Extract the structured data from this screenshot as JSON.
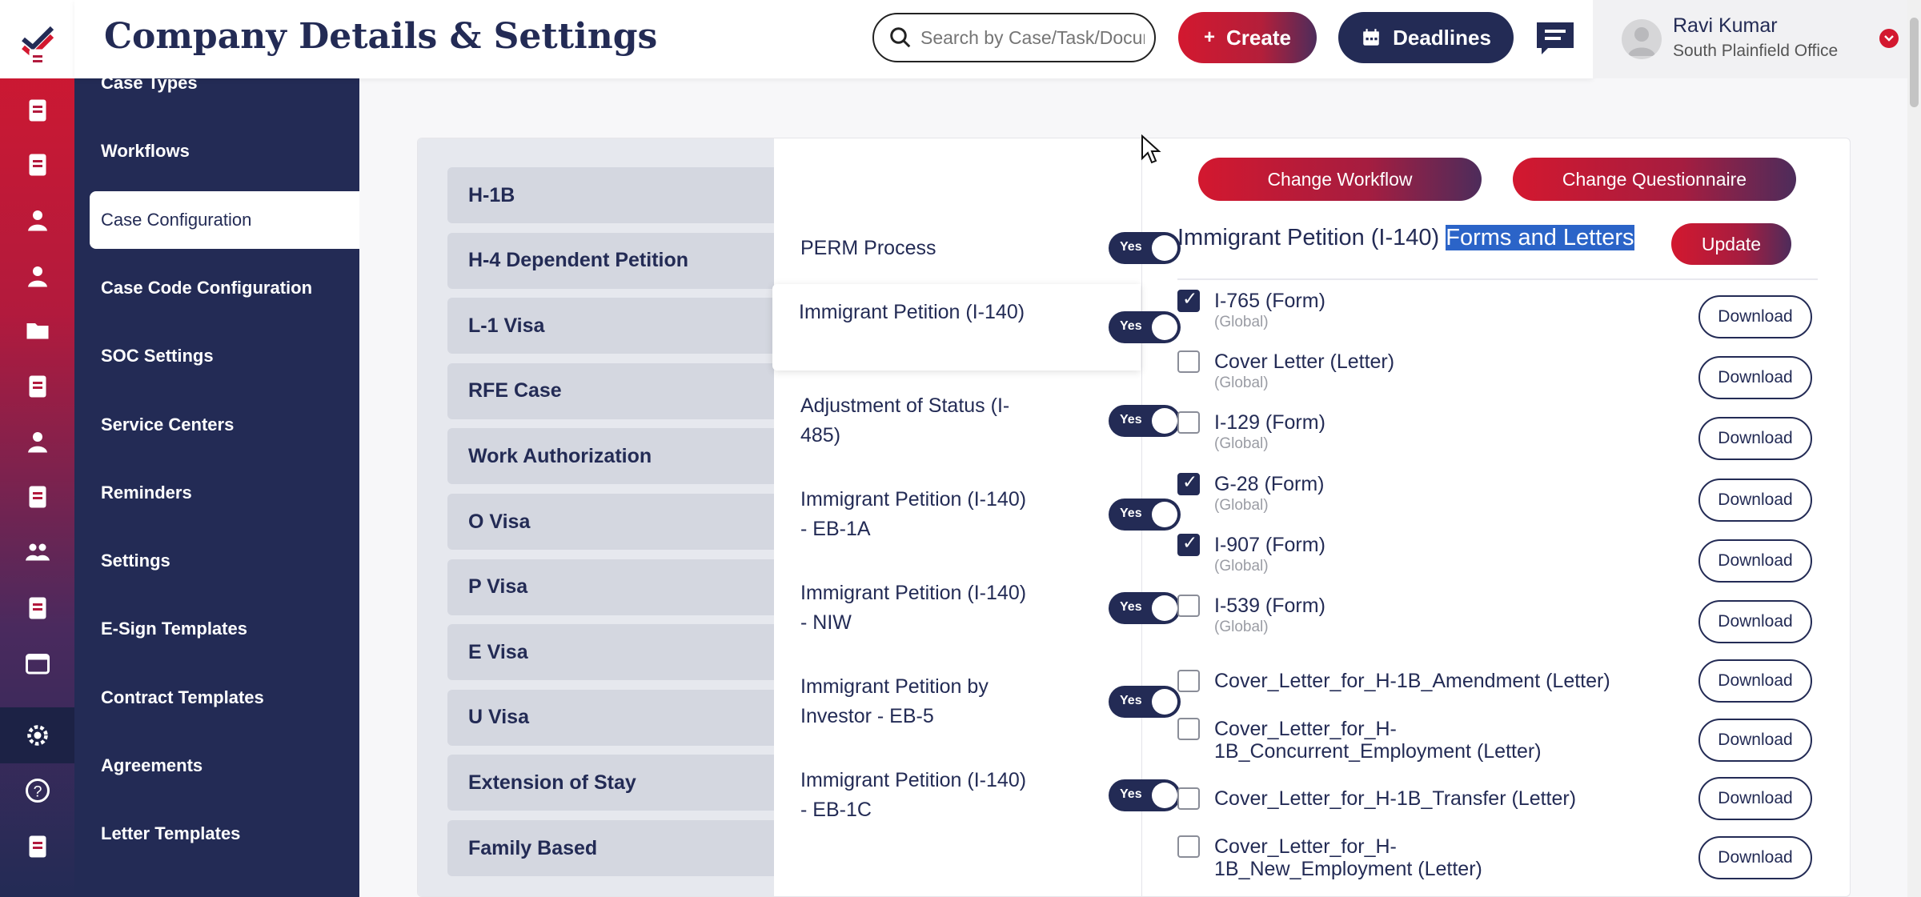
{
  "header": {
    "title": "Company Details & Settings",
    "search_placeholder": "Search by Case/Task/Document",
    "create_label": "Create",
    "deadlines_label": "Deadlines"
  },
  "user": {
    "name": "Ravi Kumar",
    "office": "South Plainfield Office"
  },
  "rail_icons": [
    "edit-icon",
    "document-settings-icon",
    "clipboard-icon",
    "user-icon",
    "person-icon",
    "folder-icon",
    "note-icon",
    "support-agent-icon",
    "ledger-icon",
    "team-settings-icon",
    "edit-document-icon",
    "calendar-settings-icon",
    "gear-icon",
    "help-icon",
    "contacts-book-icon"
  ],
  "sidebar": {
    "items": [
      {
        "label": "Case Types"
      },
      {
        "label": "Workflows"
      },
      {
        "label": "Case Configuration",
        "active": true
      },
      {
        "label": "Case Code Configuration"
      },
      {
        "label": "SOC Settings"
      },
      {
        "label": "Service Centers"
      },
      {
        "label": "Reminders"
      },
      {
        "label": "Settings"
      },
      {
        "label": "E-Sign Templates"
      },
      {
        "label": "Contract Templates"
      },
      {
        "label": "Agreements"
      },
      {
        "label": "Letter Templates"
      }
    ]
  },
  "case_types": [
    "H-1B",
    "H-4 Dependent Petition",
    "L-1 Visa",
    "RFE Case",
    "Work Authorization",
    "O Visa",
    "P Visa",
    "E Visa",
    "U Visa",
    "Extension of Stay",
    "Family Based"
  ],
  "processes": [
    {
      "label": "PERM Process",
      "toggle": "Yes"
    },
    {
      "label": "Immigrant Petition (I-140)",
      "toggle": "Yes",
      "active": true
    },
    {
      "label": "Adjustment of Status (I-485)",
      "toggle": "Yes"
    },
    {
      "label": "Immigrant Petition (I-140) - EB-1A",
      "toggle": "Yes"
    },
    {
      "label": "Immigrant Petition (I-140) - NIW",
      "toggle": "Yes"
    },
    {
      "label": "Immigrant Petition by Investor - EB-5",
      "toggle": "Yes"
    },
    {
      "label": "Immigrant Petition (I-140) - EB-1C",
      "toggle": "Yes"
    }
  ],
  "panel": {
    "change_workflow_label": "Change Workflow",
    "change_questionnaire_label": "Change Questionnaire",
    "title_prefix": "Immigrant Petition (I-140)",
    "title_highlight": "Forms and Letters",
    "update_label": "Update",
    "download_label": "Download",
    "forms": [
      {
        "name": "I-765 (Form)",
        "scope": "(Global)",
        "checked": true
      },
      {
        "name": "Cover Letter (Letter)",
        "scope": "(Global)",
        "checked": false
      },
      {
        "name": "I-129 (Form)",
        "scope": "(Global)",
        "checked": false
      },
      {
        "name": "G-28 (Form)",
        "scope": "(Global)",
        "checked": true
      },
      {
        "name": "I-907 (Form)",
        "scope": "(Global)",
        "checked": true
      },
      {
        "name": "I-539 (Form)",
        "scope": "(Global)",
        "checked": false
      },
      {
        "name": "Cover_Letter_for_H-1B_Amendment (Letter)",
        "scope": "",
        "checked": false
      },
      {
        "name": "Cover_Letter_for_H-1B_Concurrent_Employment (Letter)",
        "scope": "",
        "checked": false
      },
      {
        "name": "Cover_Letter_for_H-1B_Transfer (Letter)",
        "scope": "",
        "checked": false
      },
      {
        "name": "Cover_Letter_for_H-1B_New_Employment (Letter)",
        "scope": "",
        "checked": false
      }
    ]
  },
  "colors": {
    "brand_red": "#d3182f",
    "navy": "#232b55",
    "highlight": "#2b64c8"
  }
}
